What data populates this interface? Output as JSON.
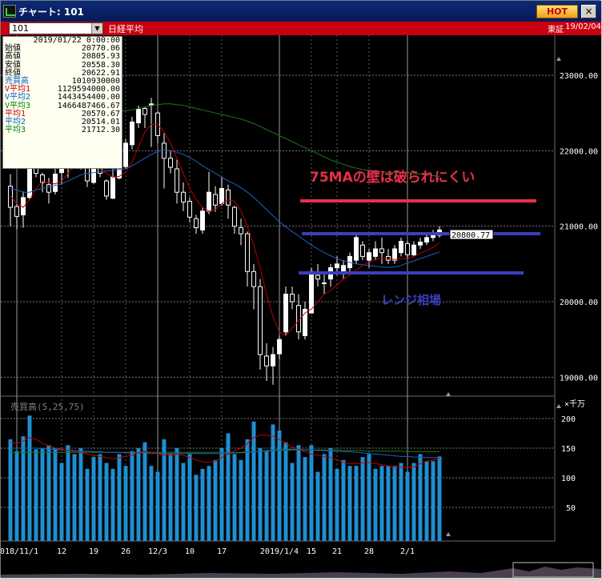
{
  "window": {
    "title": "チャート: 101",
    "hot_label": "HOT",
    "close_label": "×"
  },
  "toolbar": {
    "symbol": "101",
    "dropdown_glyph": "▼",
    "index_name": "日経平均",
    "exchange": "東証",
    "date": "19/02/04"
  },
  "info_panel": {
    "date": "2019/01/22 0:00:00",
    "rows": [
      {
        "label": "始値",
        "value": "20770.06",
        "color": "#000000"
      },
      {
        "label": "高値",
        "value": "20805.93",
        "color": "#000000"
      },
      {
        "label": "安値",
        "value": "20558.30",
        "color": "#000000"
      },
      {
        "label": "終値",
        "value": "20622.91",
        "color": "#000000"
      },
      {
        "label": "売買高",
        "value": "1010930000",
        "color": "#0060c0"
      },
      {
        "label": "V平均1",
        "value": "1129594000.00",
        "color": "#c00000"
      },
      {
        "label": "V平均2",
        "value": "1443454400.00",
        "color": "#0060c0"
      },
      {
        "label": "V平均3",
        "value": "1466487466.67",
        "color": "#008000"
      },
      {
        "label": "平均1",
        "value": "20570.67",
        "color": "#c00000"
      },
      {
        "label": "平均2",
        "value": "20514.01",
        "color": "#0060c0"
      },
      {
        "label": "平均3",
        "value": "21712.30",
        "color": "#008000"
      }
    ]
  },
  "annotations": {
    "wall_text": "75MAの壁は破られにくい",
    "range_text": "レンジ相場",
    "price_box": "20800.77",
    "wall_color": "#e8304a",
    "range_color": "#3a3fc0"
  },
  "colors": {
    "bull": "#ffffff",
    "bear": "#000000",
    "ma1": "#c00000",
    "ma2": "#1f5fc0",
    "ma3": "#1a7a1a",
    "volume": "#1f8fd0"
  },
  "chart_data": [
    {
      "type": "candlestick",
      "title": "日経平均",
      "ylim": [
        18800,
        23600
      ],
      "y_ticks": [
        "23000.00",
        "22000.00",
        "21000.00",
        "20000.00",
        "19000.00"
      ],
      "x_tick_labels": [
        "2018/11/1",
        "12",
        "19",
        "26",
        "12/3",
        "10",
        "17",
        "2019/1/4",
        "15",
        "21",
        "28",
        "2/1"
      ],
      "candles": [
        [
          21530,
          21690,
          21000,
          21250
        ],
        [
          21260,
          21300,
          20960,
          21130
        ],
        [
          21150,
          21460,
          20980,
          21380
        ],
        [
          21380,
          21980,
          21350,
          21820
        ],
        [
          21790,
          22030,
          21650,
          21700
        ],
        [
          21680,
          21710,
          21450,
          21580
        ],
        [
          21550,
          21640,
          21300,
          21450
        ],
        [
          21460,
          21780,
          21420,
          21690
        ],
        [
          21710,
          21920,
          21550,
          21780
        ],
        [
          21770,
          21960,
          21640,
          21880
        ],
        [
          21900,
          22200,
          21850,
          22130
        ],
        [
          22100,
          22120,
          21750,
          21800
        ],
        [
          21800,
          21820,
          21520,
          21600
        ],
        [
          21580,
          21880,
          21560,
          21810
        ],
        [
          21790,
          22070,
          21650,
          21700
        ],
        [
          21600,
          21620,
          21350,
          21400
        ],
        [
          21370,
          21760,
          21360,
          21650
        ],
        [
          21640,
          21900,
          21620,
          21800
        ],
        [
          21790,
          22160,
          21760,
          22100
        ],
        [
          22080,
          22450,
          22020,
          22380
        ],
        [
          22370,
          22600,
          22300,
          22550
        ],
        [
          22560,
          22580,
          22300,
          22480
        ],
        [
          22600,
          22700,
          22050,
          22620
        ],
        [
          22500,
          22520,
          22100,
          22200
        ],
        [
          22100,
          22230,
          21500,
          21900
        ],
        [
          21900,
          22000,
          21700,
          21780
        ],
        [
          21760,
          21880,
          21300,
          21450
        ],
        [
          21450,
          21580,
          21200,
          21320
        ],
        [
          21330,
          21380,
          21050,
          21120
        ],
        [
          21100,
          21150,
          20900,
          20980
        ],
        [
          20950,
          21250,
          20900,
          21200
        ],
        [
          21200,
          21720,
          21160,
          21450
        ],
        [
          21420,
          21530,
          21190,
          21280
        ],
        [
          21300,
          21650,
          21270,
          21500
        ],
        [
          21480,
          21550,
          21100,
          21280
        ],
        [
          21250,
          21270,
          20900,
          21000
        ],
        [
          20980,
          21100,
          20750,
          20900
        ],
        [
          20900,
          20930,
          20200,
          20400
        ],
        [
          20400,
          20500,
          19900,
          20200
        ],
        [
          20200,
          20300,
          19100,
          19300
        ],
        [
          19280,
          19450,
          18950,
          19150
        ],
        [
          19150,
          19400,
          18900,
          19300
        ],
        [
          19310,
          19550,
          19240,
          19500
        ],
        [
          19600,
          20200,
          19550,
          20100
        ],
        [
          20100,
          20200,
          19900,
          20000
        ],
        [
          19950,
          20100,
          19500,
          19600
        ],
        [
          19550,
          20000,
          19500,
          19900
        ],
        [
          19850,
          20450,
          19850,
          20400
        ],
        [
          20350,
          20500,
          20200,
          20300
        ],
        [
          20250,
          20400,
          20100,
          20250
        ],
        [
          20300,
          20500,
          20200,
          20450
        ],
        [
          20450,
          20600,
          20350,
          20500
        ],
        [
          20400,
          20550,
          20300,
          20480
        ],
        [
          20450,
          20650,
          20400,
          20600
        ],
        [
          20550,
          20900,
          20500,
          20850
        ],
        [
          20750,
          20800,
          20550,
          20600
        ],
        [
          20550,
          20700,
          20450,
          20650
        ],
        [
          20600,
          20800,
          20550,
          20700
        ],
        [
          20700,
          20850,
          20500,
          20650
        ],
        [
          20600,
          20700,
          20500,
          20550
        ],
        [
          20550,
          20750,
          20500,
          20700
        ],
        [
          20650,
          20850,
          20600,
          20800
        ],
        [
          20770,
          20806,
          20558,
          20623
        ],
        [
          20620,
          20800,
          20600,
          20750
        ],
        [
          20750,
          20850,
          20700,
          20790
        ],
        [
          20790,
          20900,
          20750,
          20850
        ],
        [
          20850,
          20950,
          20800,
          20900
        ],
        [
          20880,
          21000,
          20850,
          20950
        ]
      ],
      "ma1": [
        21400,
        21300,
        21250,
        21350,
        21500,
        21600,
        21580,
        21560,
        21600,
        21700,
        21800,
        21850,
        21820,
        21790,
        21760,
        21700,
        21650,
        21660,
        21720,
        21850,
        22050,
        22250,
        22350,
        22350,
        22250,
        22100,
        21900,
        21700,
        21500,
        21350,
        21250,
        21200,
        21220,
        21300,
        21350,
        21330,
        21200,
        21000,
        20750,
        20450,
        20100,
        19800,
        19600,
        19550,
        19650,
        19750,
        19850,
        19900,
        20000,
        20100,
        20150,
        20220,
        20300,
        20350,
        20420,
        20480,
        20520,
        20560,
        20580,
        20570,
        20560,
        20570,
        20571,
        20600,
        20640,
        20680,
        20720,
        20780
      ],
      "ma2": [
        21500,
        21480,
        21450,
        21450,
        21480,
        21500,
        21520,
        21540,
        21560,
        21600,
        21640,
        21680,
        21700,
        21710,
        21720,
        21730,
        21740,
        21750,
        21760,
        21800,
        21850,
        21900,
        21950,
        21990,
        22010,
        22000,
        21980,
        21950,
        21910,
        21860,
        21800,
        21750,
        21700,
        21650,
        21600,
        21560,
        21510,
        21450,
        21380,
        21300,
        21220,
        21140,
        21060,
        20990,
        20930,
        20870,
        20810,
        20750,
        20700,
        20650,
        20610,
        20570,
        20540,
        20520,
        20500,
        20490,
        20480,
        20470,
        20460,
        20455,
        20460,
        20480,
        20514,
        20540,
        20570,
        20600,
        20630,
        20660
      ],
      "ma3": [
        22400,
        22420,
        22440,
        22450,
        22460,
        22470,
        22470,
        22470,
        22470,
        22480,
        22490,
        22500,
        22510,
        22520,
        22520,
        22520,
        22520,
        22520,
        22530,
        22540,
        22560,
        22580,
        22600,
        22610,
        22620,
        22620,
        22610,
        22600,
        22580,
        22560,
        22540,
        22520,
        22500,
        22480,
        22460,
        22440,
        22420,
        22390,
        22360,
        22320,
        22280,
        22240,
        22200,
        22160,
        22120,
        22080,
        22040,
        22000,
        21960,
        21920,
        21880,
        21850,
        21820,
        21790,
        21770,
        21750,
        21740,
        21730,
        21720,
        21715,
        21713,
        21712,
        21712,
        21700,
        21690,
        21680,
        21670,
        21660
      ]
    },
    {
      "type": "bar",
      "title": "売買高",
      "params": "(5,25,75)",
      "unit": "×千万",
      "ylim": [
        0,
        220
      ],
      "y_ticks": [
        "200",
        "150",
        "100",
        "50"
      ],
      "values": [
        165,
        145,
        170,
        205,
        148,
        150,
        155,
        150,
        125,
        155,
        140,
        150,
        115,
        135,
        140,
        125,
        115,
        140,
        120,
        145,
        150,
        160,
        120,
        110,
        165,
        140,
        150,
        125,
        140,
        105,
        115,
        120,
        130,
        150,
        175,
        140,
        130,
        165,
        195,
        150,
        145,
        190,
        180,
        160,
        125,
        155,
        135,
        155,
        110,
        140,
        150,
        115,
        130,
        120,
        120,
        135,
        140,
        115,
        120,
        120,
        120,
        125,
        110,
        125,
        140,
        128,
        128,
        136
      ],
      "ma1": [
        160,
        158,
        162,
        168,
        165,
        158,
        154,
        150,
        148,
        146,
        144,
        142,
        140,
        138,
        136,
        134,
        132,
        134,
        136,
        138,
        142,
        145,
        143,
        140,
        138,
        138,
        140,
        138,
        134,
        130,
        127,
        126,
        128,
        134,
        140,
        146,
        150,
        158,
        168,
        172,
        172,
        170,
        165,
        158,
        152,
        148,
        144,
        140,
        138,
        136,
        134,
        130,
        126,
        124,
        124,
        125,
        126,
        124,
        122,
        120,
        118,
        118,
        117,
        118,
        124,
        128,
        130,
        132
      ],
      "ma2": [
        150,
        150,
        150,
        150,
        150,
        149,
        148,
        148,
        147,
        146,
        146,
        145,
        145,
        144,
        144,
        143,
        143,
        143,
        142,
        142,
        142,
        142,
        141,
        141,
        141,
        141,
        141,
        141,
        141,
        141,
        141,
        141,
        141,
        141,
        141,
        142,
        142,
        143,
        144,
        145,
        146,
        147,
        148,
        148,
        148,
        148,
        147,
        147,
        146,
        146,
        145,
        145,
        144,
        144,
        143,
        142,
        141,
        140,
        139,
        138,
        137,
        136,
        136,
        135,
        135,
        134,
        134,
        134
      ],
      "ma3": [
        143,
        143,
        143,
        143,
        143,
        143,
        143,
        143,
        143,
        143,
        143,
        143,
        143,
        143,
        143,
        143,
        143,
        143,
        143,
        143,
        143,
        143,
        143,
        143,
        143,
        143,
        143,
        143,
        143,
        143,
        143,
        143,
        143,
        143,
        143,
        143,
        143,
        144,
        144,
        145,
        145,
        146,
        146,
        146,
        147,
        147,
        147,
        147,
        147,
        147,
        147,
        147,
        146,
        146,
        146,
        146,
        145,
        145,
        145,
        145,
        145,
        145,
        144,
        144,
        144,
        144,
        144,
        144
      ]
    }
  ]
}
